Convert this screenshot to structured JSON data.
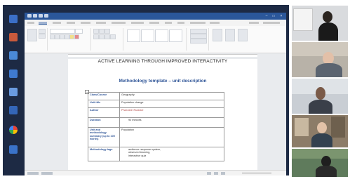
{
  "document": {
    "heading": "ACTIVE LEARNING THROUGH IMPROVED INTERACTIVITY",
    "subheading": "Methodology template – unit description",
    "table_rows": [
      {
        "label": "Class/Course",
        "value": "Geography"
      },
      {
        "label": "Unit title",
        "value": "Population change"
      },
      {
        "label": "Author",
        "value": "Phan Anh Rudolce"
      },
      {
        "label": "Duration",
        "value": "90 minutes"
      },
      {
        "label": "Unit and methodology summary (up to 100 words)",
        "value": "Population"
      },
      {
        "label": "Methodology tags",
        "value": "audience response system,\nobserved learning,\ninteractive quiz"
      }
    ]
  },
  "colors": {
    "word_blue": "#2b579a",
    "heading_blue": "#2f5597",
    "desktop": "#1d2a44"
  },
  "video_tiles": [
    "participant-1",
    "participant-2",
    "participant-3",
    "participant-4",
    "participant-5"
  ]
}
